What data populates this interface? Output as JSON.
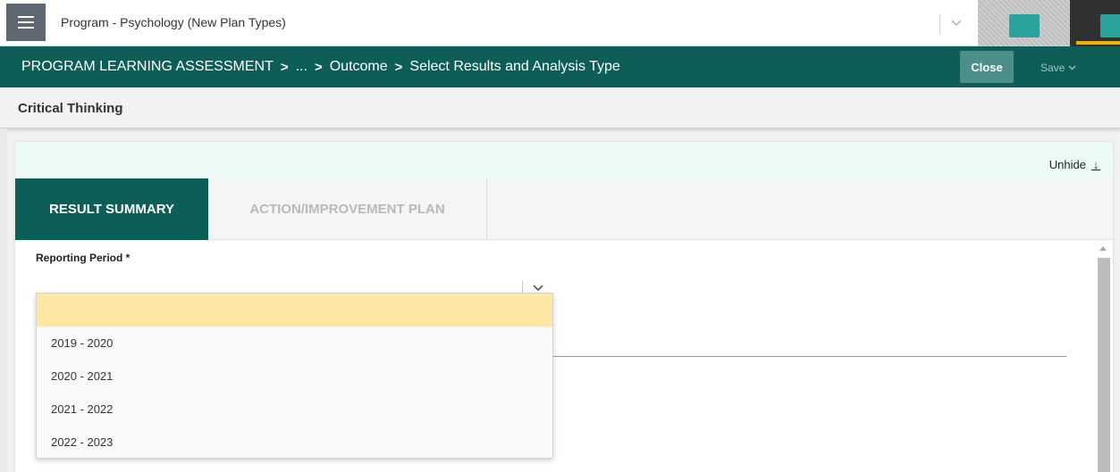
{
  "topbar": {
    "program_title": "Program - Psychology (New Plan Types)",
    "menu_icon": "hamburger-menu-icon",
    "colors": {
      "accent_teal": "#2aa39d",
      "accent_orange": "#f2b100"
    }
  },
  "breadcrumb": {
    "items": [
      "PROGRAM LEARNING ASSESSMENT",
      "...",
      "Outcome",
      "Select Results and Analysis Type"
    ],
    "separator": ">",
    "close_label": "Close",
    "save_label": "Save"
  },
  "page": {
    "title": "Critical Thinking"
  },
  "panel": {
    "unhide_label": "Unhide",
    "unhide_icon": "arrow-down-underline-icon",
    "tabs": [
      {
        "label": "RESULT SUMMARY",
        "active": true
      },
      {
        "label": "ACTION/IMPROVEMENT PLAN",
        "active": false
      }
    ]
  },
  "form": {
    "reporting_period_label": "Reporting Period *",
    "reporting_period_value": "",
    "options": [
      "",
      "2019 - 2020",
      "2020 - 2021",
      "2021 - 2022",
      "2022 - 2023"
    ],
    "highlight_color": "#fce7a5"
  },
  "theme": {
    "primary": "#0d5e57"
  }
}
